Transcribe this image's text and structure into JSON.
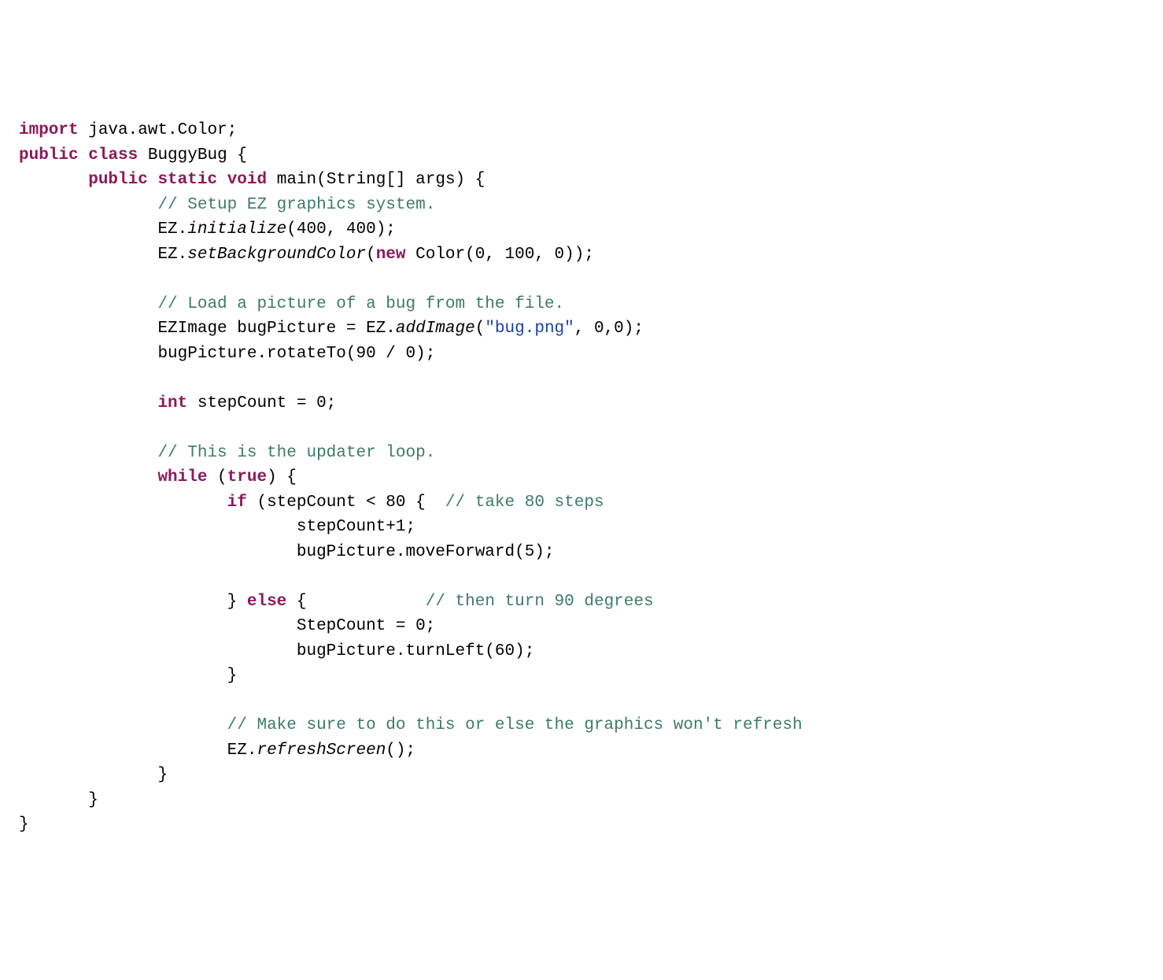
{
  "code": {
    "l1_kw1": "import",
    "l1_rest": " java.awt.Color;",
    "l2_kw1": "public",
    "l2_kw2": "class",
    "l2_rest": " BuggyBug {",
    "l3_kw1": "public",
    "l3_kw2": "static",
    "l3_kw3": "void",
    "l3_rest": " main(String[] args) {",
    "l4_cm": "// Setup EZ graphics system.",
    "l5_a": "EZ.",
    "l5_i": "initialize",
    "l5_b": "(400, 400);",
    "l6_a": "EZ.",
    "l6_i": "setBackgroundColor",
    "l6_b": "(",
    "l6_kw": "new",
    "l6_c": " Color(0, 100, 0));",
    "l8_cm": "// Load a picture of a bug from the file.",
    "l9_a": "EZImage bugPicture = EZ.",
    "l9_i": "addImage",
    "l9_b": "(",
    "l9_str": "\"bug.png\"",
    "l9_c": ", 0,0);",
    "l10": "bugPicture.rotateTo(90 / 0);",
    "l12_kw": "int",
    "l12_rest": " stepCount = 0;",
    "l14_cm": "// This is the updater loop.",
    "l15_kw": "while",
    "l15_b": " (",
    "l15_kw2": "true",
    "l15_c": ") {",
    "l16_kw": "if",
    "l16_b": " (stepCount < 80 {  ",
    "l16_cm": "// take 80 steps",
    "l17": "stepCount+1;",
    "l18": "bugPicture.moveForward(5);",
    "l20_a": "} ",
    "l20_kw": "else",
    "l20_b": " {            ",
    "l20_cm": "// then turn 90 degrees",
    "l21": "StepCount = 0;",
    "l22": "bugPicture.turnLeft(60);",
    "l23": "}",
    "l25_cm": "// Make sure to do this or else the graphics won't refresh",
    "l26_a": "EZ.",
    "l26_i": "refreshScreen",
    "l26_b": "();",
    "l27": "}",
    "l28": "}",
    "l29": "}"
  }
}
